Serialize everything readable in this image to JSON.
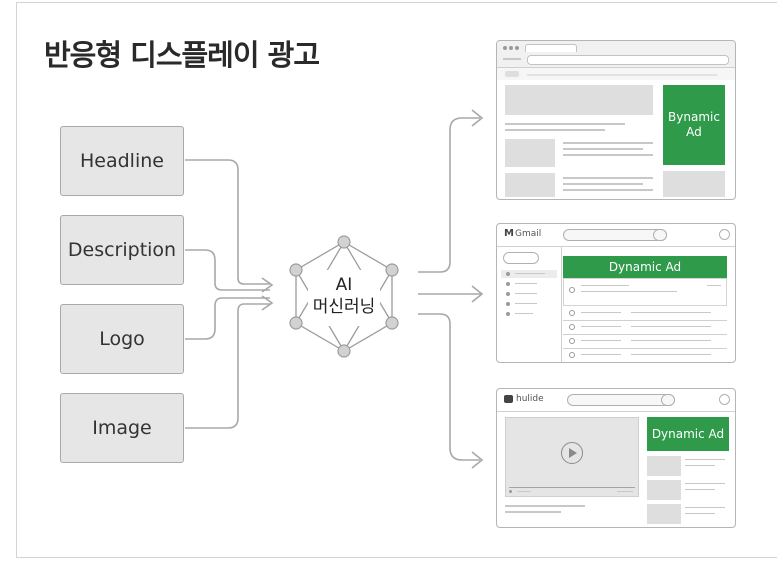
{
  "title": "반응형 디스플레이 광고",
  "inputs": [
    {
      "label": "Headline"
    },
    {
      "label": "Description"
    },
    {
      "label": "Logo"
    },
    {
      "label": "Image"
    }
  ],
  "engine": {
    "line1": "AI",
    "line2": "머신러닝"
  },
  "outputs": {
    "web": {
      "ad_line1": "Bynamic",
      "ad_line2": "Ad"
    },
    "gmail": {
      "app_name": "Gmail",
      "ad_label": "Dynamic Ad"
    },
    "video": {
      "app_name": "hulide",
      "ad_label": "Dynamic Ad"
    }
  },
  "colors": {
    "ad_green": "#2e9a4a",
    "input_fill": "#e6e6e6",
    "line": "#a8a8a8"
  },
  "icons": [
    "gmail-logo-icon",
    "video-logo-icon",
    "play-icon"
  ]
}
